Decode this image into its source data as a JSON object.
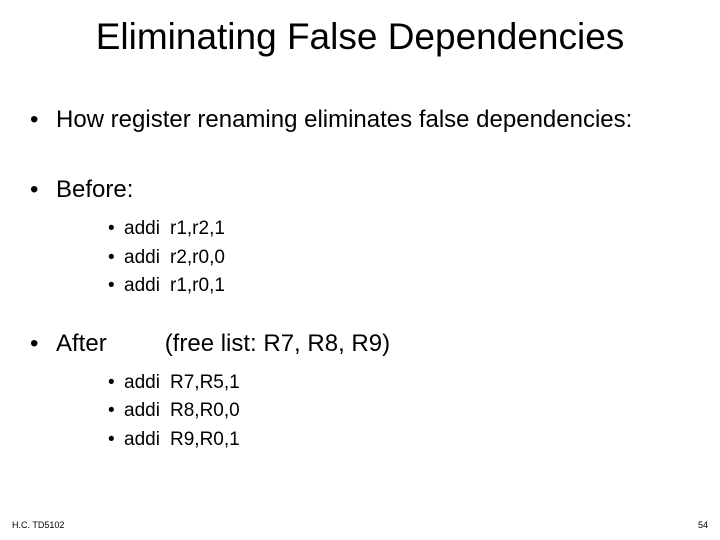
{
  "title": "Eliminating False Dependencies",
  "bullet_intro": "How register renaming eliminates false dependencies:",
  "before_label": "Before:",
  "before_code": [
    {
      "op": "addi",
      "args": "r1,r2,1"
    },
    {
      "op": "addi",
      "args": "r2,r0,0"
    },
    {
      "op": "addi",
      "args": "r1,r0,1"
    }
  ],
  "after_label": "After",
  "after_note": "(free list: R7, R8, R9)",
  "after_code": [
    {
      "op": "addi",
      "args": "R7,R5,1"
    },
    {
      "op": "addi",
      "args": "R8,R0,0"
    },
    {
      "op": "addi",
      "args": "R9,R0,1"
    }
  ],
  "footer_left": "H.C.  TD5102",
  "footer_right": "54"
}
